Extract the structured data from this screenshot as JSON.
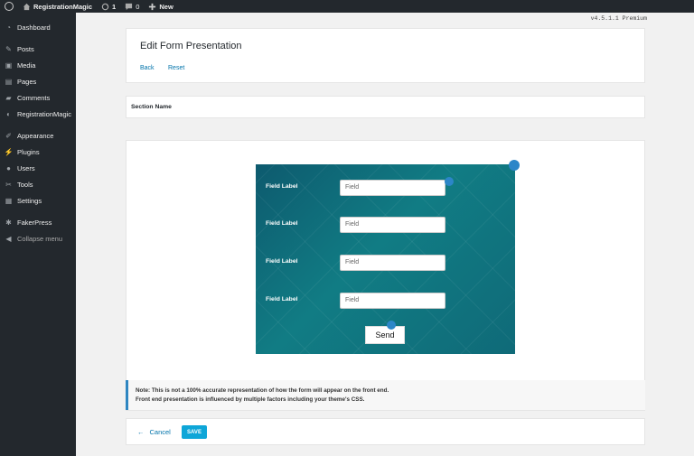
{
  "adminbar": {
    "site_name": "RegistrationMagic",
    "updates_count": "1",
    "comments_count": "0",
    "new_label": "New"
  },
  "sidebar": {
    "items": [
      {
        "label": "Dashboard",
        "icon": "dashboard-icon"
      },
      {
        "label": "Posts",
        "icon": "pin-icon"
      },
      {
        "label": "Media",
        "icon": "media-icon"
      },
      {
        "label": "Pages",
        "icon": "pages-icon"
      },
      {
        "label": "Comments",
        "icon": "comments-icon"
      },
      {
        "label": "RegistrationMagic",
        "icon": "registrationmagic-icon"
      },
      {
        "label": "Appearance",
        "icon": "brush-icon"
      },
      {
        "label": "Plugins",
        "icon": "plugin-icon"
      },
      {
        "label": "Users",
        "icon": "users-icon"
      },
      {
        "label": "Tools",
        "icon": "wrench-icon"
      },
      {
        "label": "Settings",
        "icon": "settings-icon"
      },
      {
        "label": "FakerPress",
        "icon": "fakerpress-icon"
      },
      {
        "label": "Collapse menu",
        "icon": "collapse-icon"
      }
    ]
  },
  "version": "v4.5.1.1 Premium",
  "header": {
    "title": "Edit Form Presentation",
    "back_label": "Back",
    "reset_label": "Reset"
  },
  "section": {
    "label": "Section Name"
  },
  "form": {
    "fields": [
      {
        "label": "Field Label",
        "placeholder": "Field"
      },
      {
        "label": "Field Label",
        "placeholder": "Field"
      },
      {
        "label": "Field Label",
        "placeholder": "Field"
      },
      {
        "label": "Field Label",
        "placeholder": "Field"
      }
    ],
    "submit_label": "Send"
  },
  "note": {
    "line1": "Note: This is not a 100% accurate representation of how the form will appear on the front end.",
    "line2": "Front end presentation is influenced by multiple factors including your theme's CSS."
  },
  "footer": {
    "cancel_label": "Cancel",
    "save_label": "SAVE"
  },
  "colors": {
    "admin_dark": "#23282d",
    "link_blue": "#0073aa",
    "save_blue": "#0ea6d8",
    "form_teal": "#0c6f7a",
    "handle_blue": "#2c86c8"
  }
}
